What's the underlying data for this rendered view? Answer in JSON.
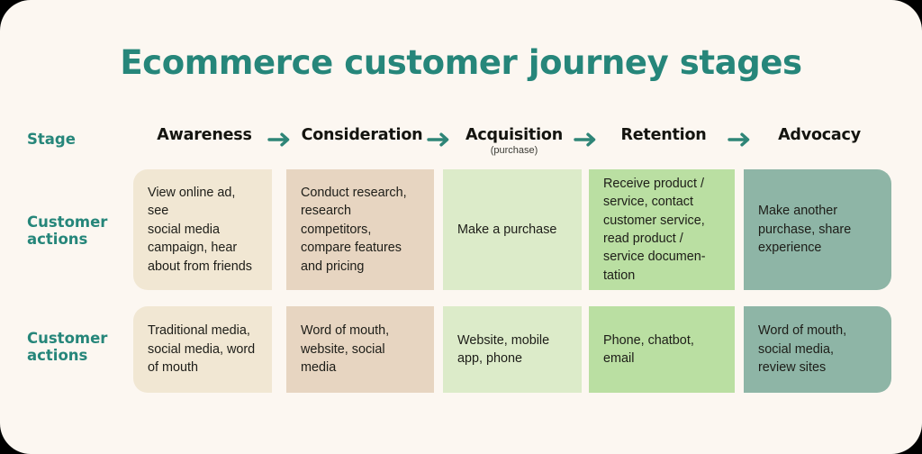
{
  "card": {
    "background": "#FCF7F1",
    "accent": "#26867A"
  },
  "title": "Ecommerce customer journey stages",
  "labels": {
    "stage": "Stage",
    "row1": "Customer\nactions",
    "row2": "Customer\nactions"
  },
  "arrow_icon": "arrow-right-icon",
  "stages": [
    {
      "name": "Awareness",
      "sub": ""
    },
    {
      "name": "Consideration",
      "sub": ""
    },
    {
      "name": "Acquisition",
      "sub": "(purchase)"
    },
    {
      "name": "Retention",
      "sub": ""
    },
    {
      "name": "Advocacy",
      "sub": ""
    }
  ],
  "column_colors": [
    "#F1E7D3",
    "#E7D5C1",
    "#DCEBC9",
    "#BADFA2",
    "#8EB5A6"
  ],
  "rows": [
    {
      "label": "Customer\nactions",
      "cells": [
        "View online ad, see\nsocial media\ncampaign, hear\nabout from friends",
        "Conduct research,\nresearch competitors,\ncompare features\nand pricing",
        "Make a purchase",
        "Receive product /\nservice, contact\ncustomer service,\nread product /\nservice documen-\ntation",
        "Make another\npurchase, share\nexperience"
      ]
    },
    {
      "label": "Customer\nactions",
      "cells": [
        "Traditional media,\nsocial media, word\nof mouth",
        "Word of mouth,\nwebsite, social\nmedia",
        "Website, mobile\napp, phone",
        "Phone, chatbot,\nemail",
        "Word of mouth,\nsocial media,\nreview sites"
      ]
    }
  ]
}
